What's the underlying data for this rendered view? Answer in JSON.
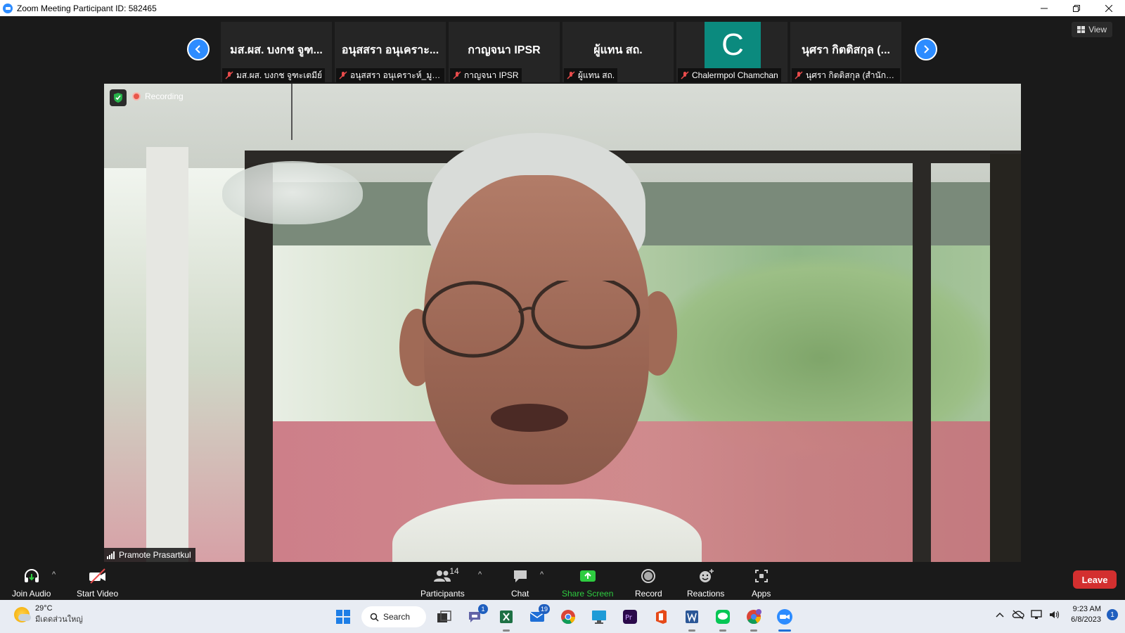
{
  "window": {
    "title": "Zoom Meeting Participant ID: 582465",
    "controls": [
      "minimize",
      "restore",
      "close"
    ]
  },
  "gallery": {
    "view_label": "View",
    "tiles": [
      {
        "display_name": "มส.ผส.  บงกช จูฑ...",
        "nameplate": "มส.ผส.  บงกช จูฑะเตมีย์",
        "muted": true
      },
      {
        "display_name": "อนุสสรา อนุเคราะ...",
        "nameplate": "อนุสสรา อนุเคราะห์_มูลนิ...",
        "muted": true
      },
      {
        "display_name": "กาญจนา IPSR",
        "nameplate": "กาญจนา IPSR",
        "muted": true
      },
      {
        "display_name": "ผู้แทน สถ.",
        "nameplate": "ผู้แทน สถ.",
        "muted": true
      },
      {
        "avatar_letter": "C",
        "nameplate": "Chalermpol Chamchan",
        "muted": true
      },
      {
        "display_name": "นุศรา  กิตติสกุล (...",
        "nameplate": "นุศรา  กิตติสกุล (สำนักงา...",
        "muted": true
      }
    ]
  },
  "main_video": {
    "recording_label": "Recording",
    "speaker_name": "Pramote Prasartkul"
  },
  "toolbar": {
    "join_audio": "Join Audio",
    "start_video": "Start Video",
    "participants": "Participants",
    "participants_count": "14",
    "chat": "Chat",
    "share_screen": "Share Screen",
    "record": "Record",
    "reactions": "Reactions",
    "apps": "Apps",
    "leave": "Leave"
  },
  "taskbar": {
    "weather_temp": "29°C",
    "weather_condition": "มีเดดส่วนใหญ่",
    "search_label": "Search",
    "badges": {
      "teams": "1",
      "mail": "19"
    },
    "time": "9:23 AM",
    "date": "6/8/2023",
    "notification_count": "1"
  },
  "colors": {
    "accent": "#2d8cff",
    "leave": "#d32f2f",
    "share": "#2ecc40",
    "avatar": "#0b8a7e",
    "recording": "#e8564a"
  }
}
